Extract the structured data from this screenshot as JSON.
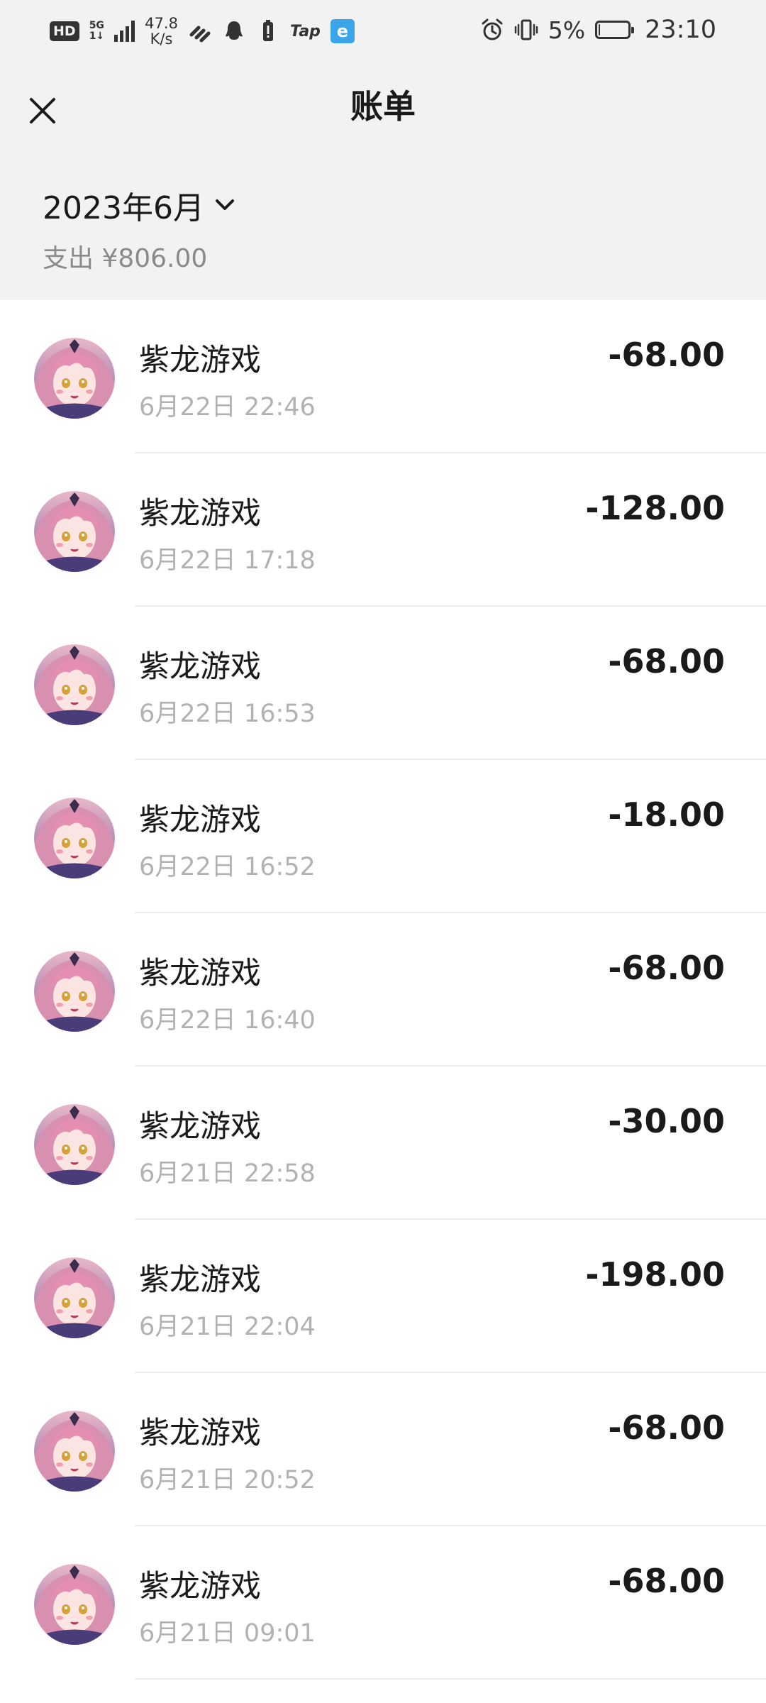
{
  "status_bar": {
    "hd": "HD",
    "network_top": "5G",
    "network_bottom": "1↓",
    "speed_value": "47.8",
    "speed_unit": "K/s",
    "tap_label": "Tap",
    "battery_percent": "5%",
    "battery_level": 0.05,
    "time": "23:10",
    "icons": [
      "hd-badge",
      "5g-icon",
      "signal-icon",
      "link-icon",
      "qq-icon",
      "battery-alert-icon",
      "tap-icon",
      "e-app-icon",
      "alarm-icon",
      "vibrate-icon",
      "battery-icon"
    ]
  },
  "header": {
    "title": "账单",
    "close_icon": "close-icon"
  },
  "summary": {
    "month": "2023年6月",
    "expense": "支出 ¥806.00",
    "dropdown_icon": "chevron-down-icon"
  },
  "transactions": [
    {
      "merchant": "紫龙游戏",
      "time": "6月22日 22:46",
      "amount": "-68.00"
    },
    {
      "merchant": "紫龙游戏",
      "time": "6月22日 17:18",
      "amount": "-128.00"
    },
    {
      "merchant": "紫龙游戏",
      "time": "6月22日 16:53",
      "amount": "-68.00"
    },
    {
      "merchant": "紫龙游戏",
      "time": "6月22日 16:52",
      "amount": "-18.00"
    },
    {
      "merchant": "紫龙游戏",
      "time": "6月22日 16:40",
      "amount": "-68.00"
    },
    {
      "merchant": "紫龙游戏",
      "time": "6月21日 22:58",
      "amount": "-30.00"
    },
    {
      "merchant": "紫龙游戏",
      "time": "6月21日 22:04",
      "amount": "-198.00"
    },
    {
      "merchant": "紫龙游戏",
      "time": "6月21日 20:52",
      "amount": "-68.00"
    },
    {
      "merchant": "紫龙游戏",
      "time": "6月21日 09:01",
      "amount": "-68.00"
    }
  ]
}
